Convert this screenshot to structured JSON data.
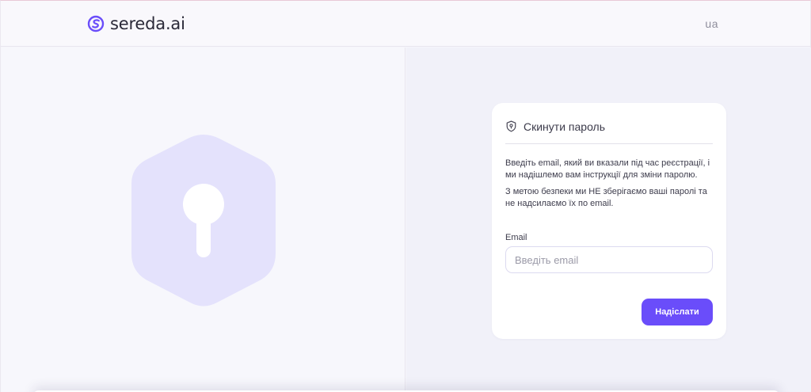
{
  "header": {
    "brand": "sereda.ai",
    "lang": "ua",
    "colors": {
      "brand_accent": "#6a4dfa"
    }
  },
  "illustration": {
    "icon": "shield-keyhole-icon",
    "color": "#e4e2fc"
  },
  "reset_card": {
    "icon": "shield-pin-icon",
    "title": "Скинути пароль",
    "paragraph_1": "Введіть email, який ви вказали під час реєстрації, і ми надішлемо вам інструкції для зміни паролю.",
    "paragraph_2": "З метою безпеки ми НЕ зберігаємо ваші паролі та не надсилаємо їх по email.",
    "email_label": "Email",
    "email_placeholder": "Введіть email",
    "email_value": "",
    "submit_label": "Надіслати"
  }
}
